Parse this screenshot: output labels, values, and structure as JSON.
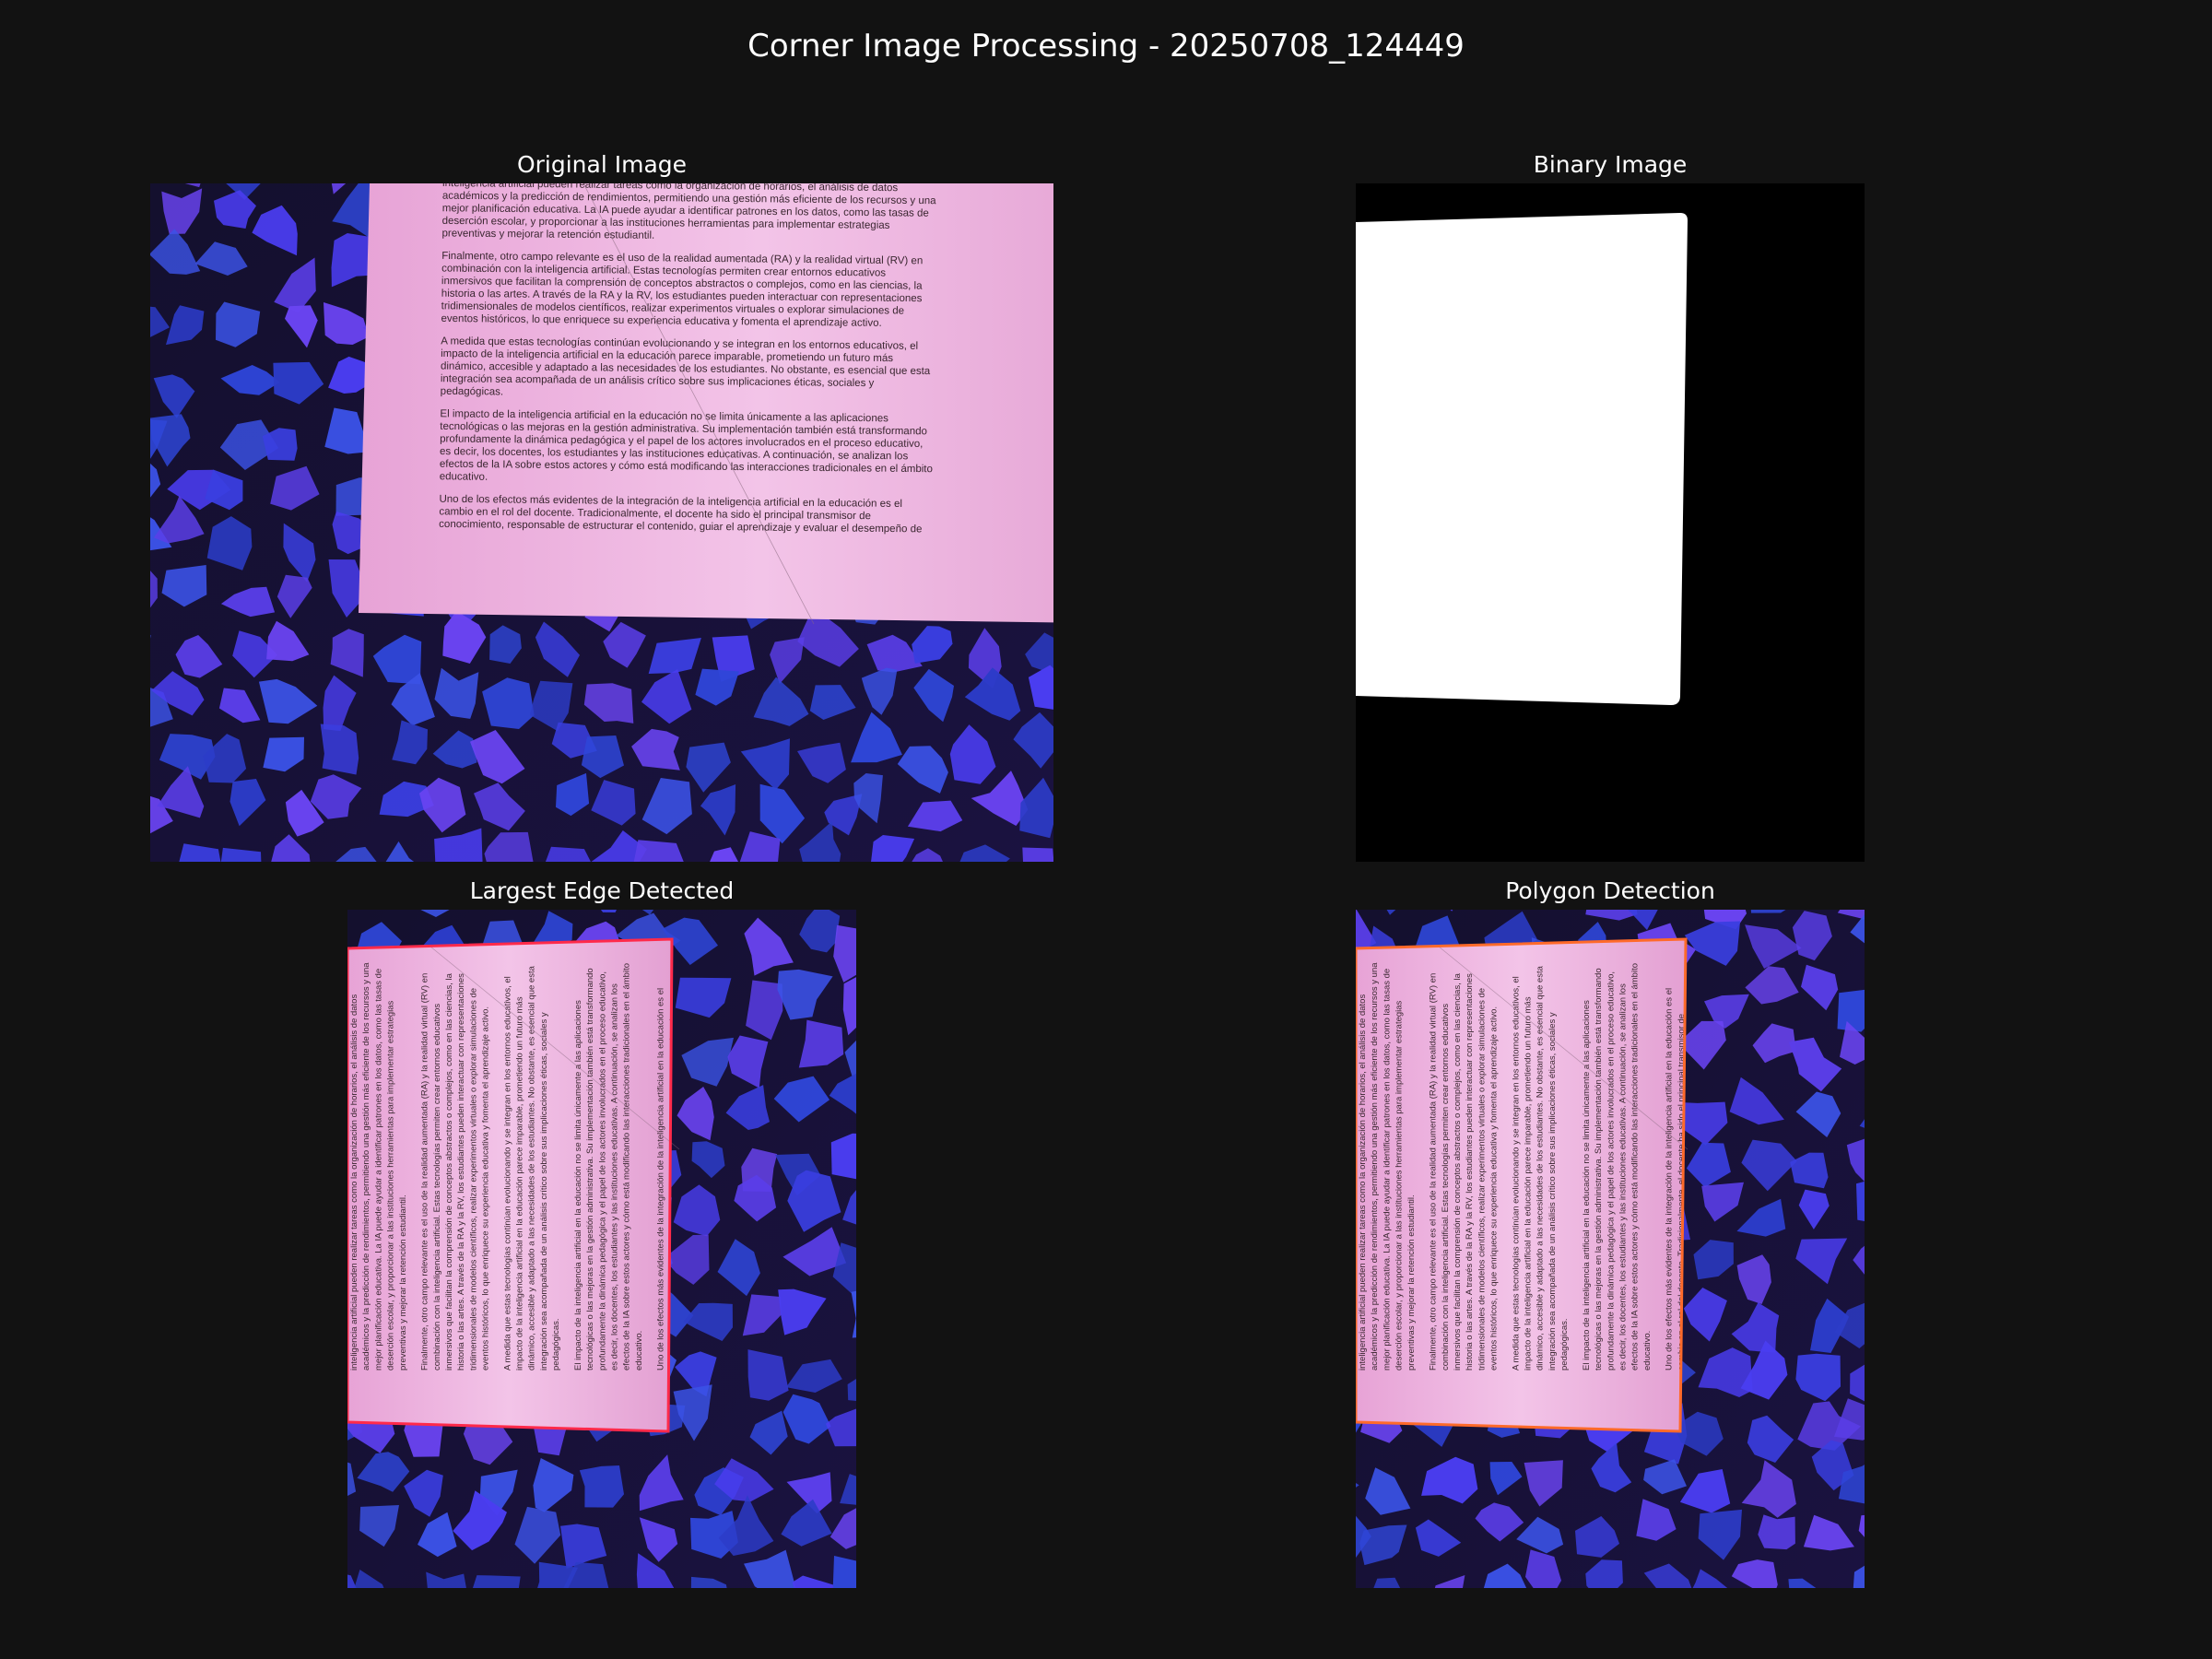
{
  "figure": {
    "title": "Corner Image Processing - 20250708_124449",
    "background": "#121212"
  },
  "panels": [
    {
      "title": "Original Image"
    },
    {
      "title": "Binary Image"
    },
    {
      "title": "Largest Edge Detected",
      "outline_color": "#ff2a4a"
    },
    {
      "title": "Polygon Detection",
      "outline_color": "#ff6a2a"
    }
  ],
  "document": {
    "paragraphs": [
      [
        "inteligencia artificial pueden realizar tareas como la organización de horarios, el análisis de datos",
        "académicos y la predicción de rendimientos, permitiendo una gestión más eficiente de los recursos y una",
        "mejor planificación educativa. La IA puede ayudar a identificar patrones en los datos, como las tasas de",
        "deserción escolar, y proporcionar a las instituciones herramientas para implementar estrategias",
        "preventivas y mejorar la retención estudiantil."
      ],
      [
        "Finalmente, otro campo relevante es el uso de la realidad aumentada (RA) y la realidad virtual (RV) en",
        "combinación con la inteligencia artificial. Estas tecnologías permiten crear entornos educativos",
        "inmersivos que facilitan la comprensión de conceptos abstractos o complejos, como en las ciencias, la",
        "historia o las artes. A través de la RA y la RV, los estudiantes pueden interactuar con representaciones",
        "tridimensionales de modelos científicos, realizar experimentos virtuales o explorar simulaciones de",
        "eventos históricos, lo que enriquece su experiencia educativa y fomenta el aprendizaje activo."
      ],
      [
        "A medida que estas tecnologías continúan evolucionando y se integran en los entornos educativos, el",
        "impacto de la inteligencia artificial en la educación parece imparable, prometiendo un futuro más",
        "dinámico, accesible y adaptado a las necesidades de los estudiantes. No obstante, es esencial que esta",
        "integración sea acompañada de un análisis crítico sobre sus implicaciones éticas, sociales y",
        "pedagógicas."
      ],
      [
        "El impacto de la inteligencia artificial en la educación no se limita únicamente a las aplicaciones",
        "tecnológicas o las mejoras en la gestión administrativa. Su implementación también está transformando",
        "profundamente la dinámica pedagógica y el papel de los actores involucrados en el proceso educativo,",
        "es decir, los docentes, los estudiantes y las instituciones educativas. A continuación, se analizan los",
        "efectos de la IA sobre estos actores y cómo está modificando las interacciones tradicionales en el ámbito",
        "educativo."
      ],
      [
        "Uno de los efectos más evidentes de la integración de la inteligencia artificial en la educación es el",
        "cambio en el rol del docente. Tradicionalmente, el docente ha sido el principal transmisor de",
        "conocimiento, responsable de estructurar el contenido, guiar el aprendizaje y evaluar el desempeño de"
      ]
    ]
  }
}
